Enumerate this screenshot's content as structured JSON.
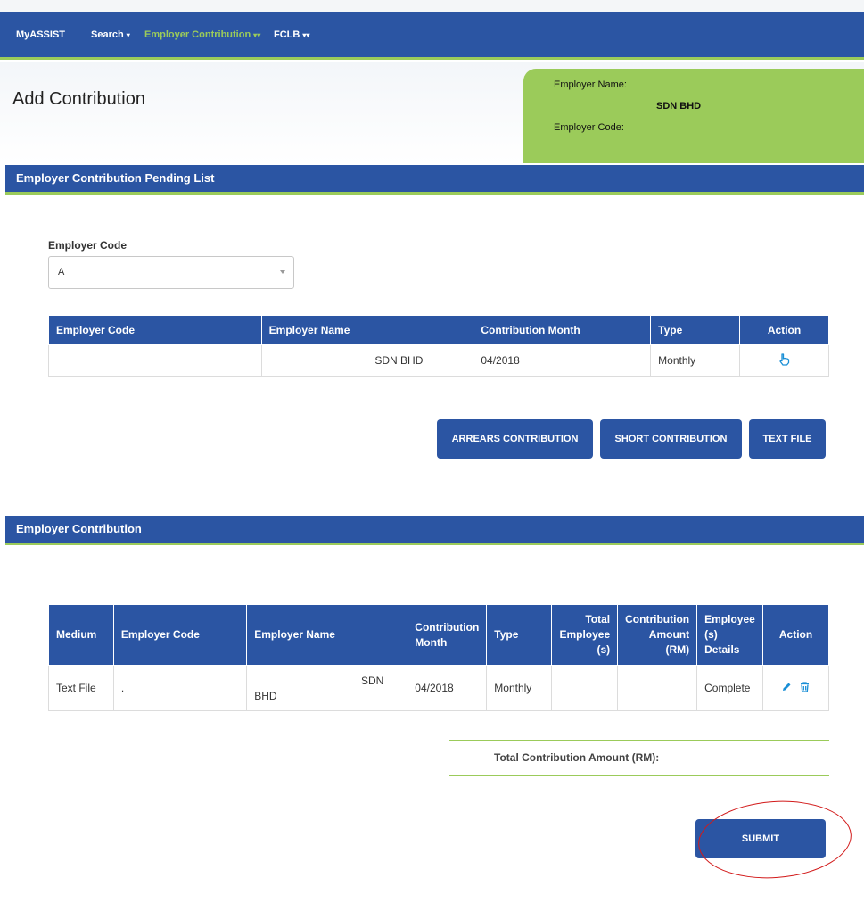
{
  "nav": {
    "brand": "MyASSIST",
    "items": [
      {
        "label": "Search",
        "caret": "▾"
      },
      {
        "label": "Employer Contribution",
        "caret": "▾▾"
      },
      {
        "label": "FCLB",
        "caret": "▾▾"
      }
    ]
  },
  "page_title": "Add Contribution",
  "employer_info": {
    "name_label": "Employer Name:",
    "name_value": "SDN BHD",
    "code_label": "Employer Code:"
  },
  "pending_section": {
    "title": "Employer Contribution Pending List",
    "filter_label": "Employer Code",
    "filter_value": "A",
    "columns": [
      "Employer Code",
      "Employer Name",
      "Contribution Month",
      "Type",
      "Action"
    ],
    "rows": [
      {
        "code": "",
        "name": "SDN BHD",
        "month": "04/2018",
        "type": "Monthly",
        "action_icon": "pointer-hand-icon"
      }
    ],
    "buttons": [
      "ARREARS CONTRIBUTION",
      "SHORT CONTRIBUTION",
      "TEXT FILE"
    ]
  },
  "contribution_section": {
    "title": "Employer Contribution",
    "columns": [
      "Medium",
      "Employer Code",
      "Employer Name",
      "Contribution Month",
      "Type",
      "Total Employee (s)",
      "Contribution Amount (RM)",
      "Employee (s) Details",
      "Action"
    ],
    "rows": [
      {
        "medium": "Text File",
        "code": ".",
        "name_line1": "SDN",
        "name_line2": "BHD",
        "month": "04/2018",
        "type": "Monthly",
        "total_employees": "",
        "amount": "",
        "details": "Complete",
        "action_icons": [
          "pencil-icon",
          "trash-icon"
        ]
      }
    ],
    "total_label": "Total Contribution Amount (RM):",
    "submit_label": "SUBMIT"
  },
  "colors": {
    "primary": "#2b55a3",
    "accent": "#9bcb5a",
    "annotation": "#d21a1a"
  }
}
